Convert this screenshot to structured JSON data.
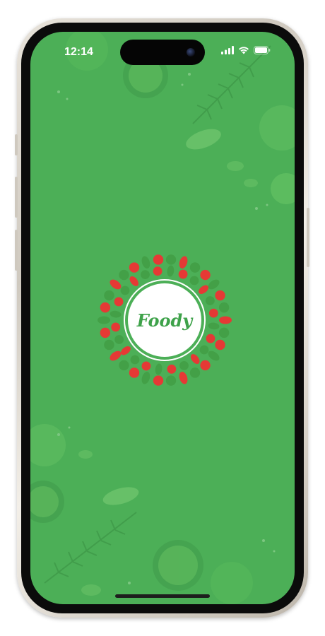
{
  "status_bar": {
    "time": "12:14",
    "signal_icon": "cellular-signal-icon",
    "wifi_icon": "wifi-icon",
    "battery_icon": "battery-icon"
  },
  "splash": {
    "logo_text": "Foody",
    "background_color": "#4caf57",
    "accent_color": "#3ea24a",
    "decoration": "vegetable-wreath"
  }
}
